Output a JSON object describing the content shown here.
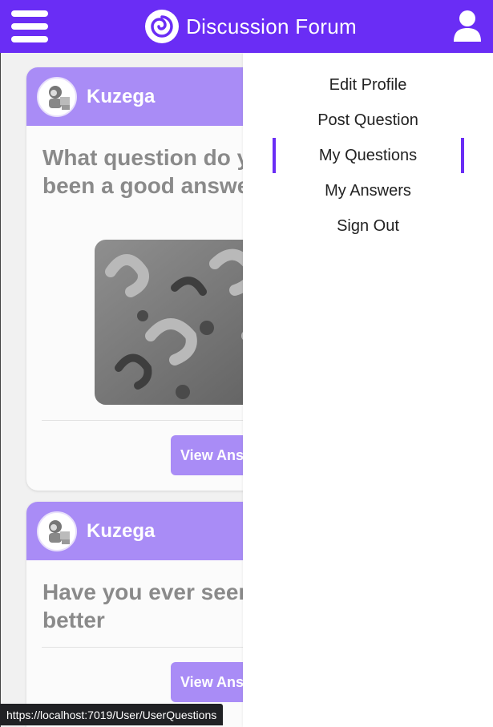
{
  "navbar": {
    "title": "Discussion Forum",
    "accent_color": "#6a2df5",
    "menu_icon": "hamburger-menu-icon",
    "logo_icon": "spiral-logo-icon",
    "user_icon": "user-profile-icon"
  },
  "posts": [
    {
      "author": "Kuzega",
      "question": "What question do y nobody has been a good answer to?",
      "image_icon": "question-marks-image",
      "button_label": "View Answ"
    },
    {
      "author": "Kuzega",
      "question": "Have you ever seen thought was better",
      "button_label": "View Answ"
    }
  ],
  "menu": {
    "items": [
      {
        "label": "Edit Profile"
      },
      {
        "label": "Post Question"
      },
      {
        "label": "My Questions",
        "active": true
      },
      {
        "label": "My Answers"
      },
      {
        "label": "Sign Out"
      }
    ]
  },
  "status_bar": {
    "url": "https://localhost:7019/User/UserQuestions"
  }
}
